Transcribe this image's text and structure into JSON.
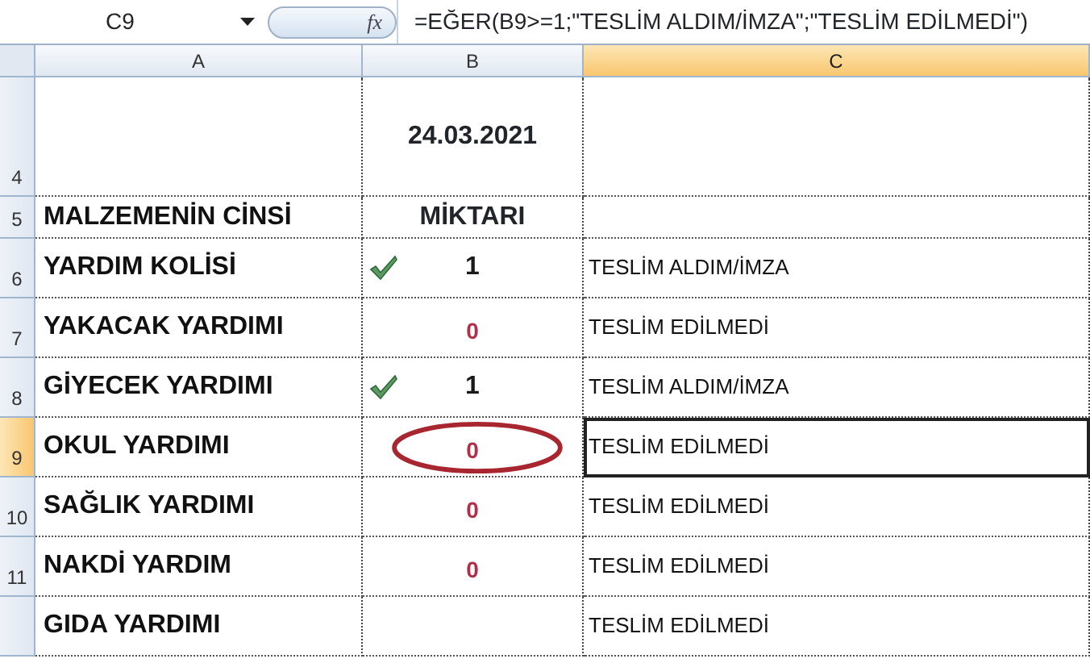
{
  "name_box": "C9",
  "formula_icon": "fx",
  "formula": "=EĞER(B9>=1;\"TESLİM ALDIM/İMZA\";\"TESLİM EDİLMEDİ\")",
  "columns": [
    {
      "label": "A",
      "selected": false
    },
    {
      "label": "B",
      "selected": false
    },
    {
      "label": "C",
      "selected": true
    }
  ],
  "rows": [
    {
      "number": "4",
      "selected": false,
      "kind": "date",
      "b": "24.03.2021"
    },
    {
      "number": "5",
      "selected": false,
      "kind": "header",
      "a": "MALZEMENİN CİNSİ",
      "b": "MİKTARI"
    },
    {
      "number": "6",
      "selected": false,
      "kind": "item",
      "a": "YARDIM KOLİSİ",
      "b": "1",
      "check": true,
      "c": "TESLİM ALDIM/İMZA",
      "cell_selected": false,
      "circled": false
    },
    {
      "number": "7",
      "selected": false,
      "kind": "item",
      "a": "YAKACAK YARDIMI",
      "b": "0",
      "check": false,
      "c": "TESLİM EDİLMEDİ",
      "cell_selected": false,
      "circled": false
    },
    {
      "number": "8",
      "selected": false,
      "kind": "item",
      "a": "GİYECEK YARDIMI",
      "b": "1",
      "check": true,
      "c": "TESLİM ALDIM/İMZA",
      "cell_selected": false,
      "circled": false
    },
    {
      "number": "9",
      "selected": true,
      "kind": "item",
      "a": "OKUL YARDIMI",
      "b": "0",
      "check": false,
      "c": "TESLİM EDİLMEDİ",
      "cell_selected": true,
      "circled": true
    },
    {
      "number": "10",
      "selected": false,
      "kind": "item",
      "a": "SAĞLIK YARDIMI",
      "b": "0",
      "check": false,
      "c": "TESLİM EDİLMEDİ",
      "cell_selected": false,
      "circled": false
    },
    {
      "number": "11",
      "selected": false,
      "kind": "item",
      "a": "NAKDİ YARDIM",
      "b": "0",
      "check": false,
      "c": "TESLİM EDİLMEDİ",
      "cell_selected": false,
      "circled": false
    },
    {
      "selected": false,
      "kind": "item",
      "a": "GIDA YARDIMI",
      "check": false,
      "c": "TESLİM EDİLMEDİ",
      "cell_selected": false,
      "circled": false
    }
  ]
}
